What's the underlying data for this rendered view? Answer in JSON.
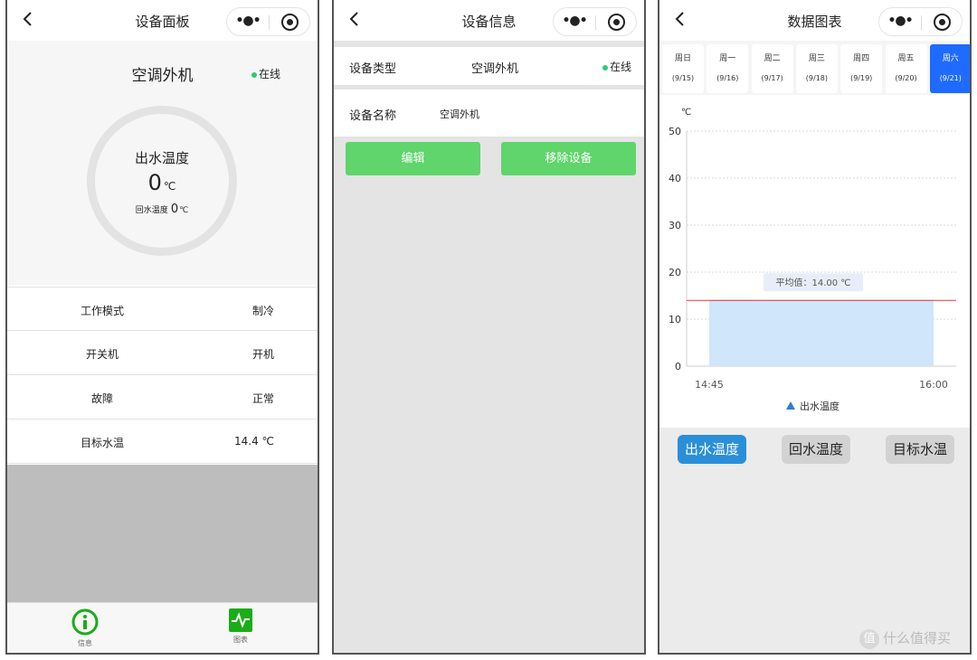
{
  "panel1": {
    "nav_title": "设备面板",
    "device_name": "空调外机",
    "status": "在线",
    "gauge": {
      "label": "出水温度",
      "value": "0",
      "unit": "℃",
      "sub_label": "回水温度",
      "sub_value": "0",
      "sub_unit": "℃"
    },
    "rows": [
      {
        "label": "工作模式",
        "value": "制冷"
      },
      {
        "label": "开关机",
        "value": "开机"
      },
      {
        "label": "故障",
        "value": "正常"
      },
      {
        "label": "目标水温",
        "value": "14.4 ℃"
      }
    ],
    "tabs": {
      "info": "信息",
      "chart": "图表"
    },
    "colors": {
      "tab_active": "#1aad19"
    }
  },
  "panel2": {
    "nav_title": "设备信息",
    "type_label": "设备类型",
    "type_value": "空调外机",
    "status": "在线",
    "name_label": "设备名称",
    "name_value": "空调外机",
    "edit_button": "编辑",
    "remove_button": "移除设备",
    "colors": {
      "button": "#5fd56b"
    }
  },
  "panel3": {
    "nav_title": "数据图表",
    "days": [
      {
        "name": "周日",
        "date": "(9/15)"
      },
      {
        "name": "周一",
        "date": "(9/16)"
      },
      {
        "name": "周二",
        "date": "(9/17)"
      },
      {
        "name": "周三",
        "date": "(9/18)"
      },
      {
        "name": "周四",
        "date": "(9/19)"
      },
      {
        "name": "周五",
        "date": "(9/20)"
      },
      {
        "name": "周六",
        "date": "(9/21)"
      }
    ],
    "selected_day": "周六",
    "series_buttons": [
      "出水温度",
      "回水温度",
      "目标水温"
    ],
    "active_series": "出水温度",
    "colors": {
      "selected_day": "#1f6bff",
      "active_button": "#2a8fd8",
      "area_fill": "#cfe6fb",
      "avg_line": "#e53935"
    }
  },
  "chart_data": {
    "type": "area",
    "y_unit_label": "℃",
    "ylim": [
      0,
      50
    ],
    "y_ticks": [
      0,
      10,
      20,
      30,
      40,
      50
    ],
    "x_ticks": [
      "14:45",
      "16:00"
    ],
    "x": [
      "14:45",
      "16:00"
    ],
    "series": [
      {
        "name": "出水温度",
        "values": [
          14,
          14
        ]
      }
    ],
    "average": {
      "label": "平均值：14.00 ℃",
      "value": 14.0
    },
    "grid": true,
    "legend": "bottom-center"
  },
  "watermark": "什么值得买"
}
